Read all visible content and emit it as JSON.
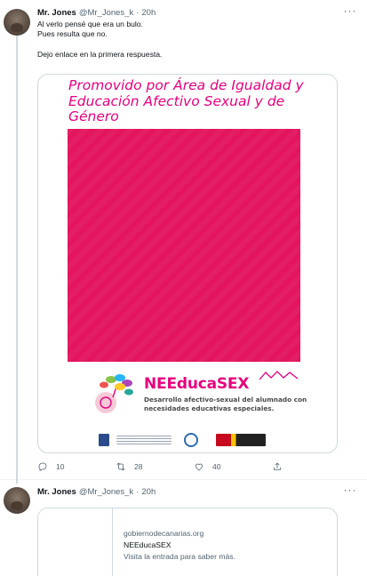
{
  "tweet1": {
    "author": {
      "name": "Mr. Jones",
      "handle": "@Mr_Jones_k",
      "time": "20h"
    },
    "more_icon": "more-horizontal-icon",
    "lines": [
      "Al verlo pensé que era un bulo.",
      "Pues resulta que no.",
      "",
      "Dejo enlace en la primera respuesta."
    ],
    "media": {
      "title": "Promovido por Área de Igualdad y Educación Afectivo Sexual y de Género",
      "brand": "NEEducaSEX",
      "subtitle": "Desarrollo afectivo-sexual del alumnado con necesidades educativas especiales.",
      "accent_color": "#e6007e"
    },
    "actions": {
      "reply_count": "10",
      "retweet_count": "28",
      "like_count": "40"
    }
  },
  "tweet2": {
    "author": {
      "name": "Mr. Jones",
      "handle": "@Mr_Jones_k",
      "time": "20h"
    },
    "link": {
      "domain": "gobiernodecanarias.org",
      "title": "NEEducaSEX",
      "description": "Visita la entrada para saber más."
    }
  }
}
